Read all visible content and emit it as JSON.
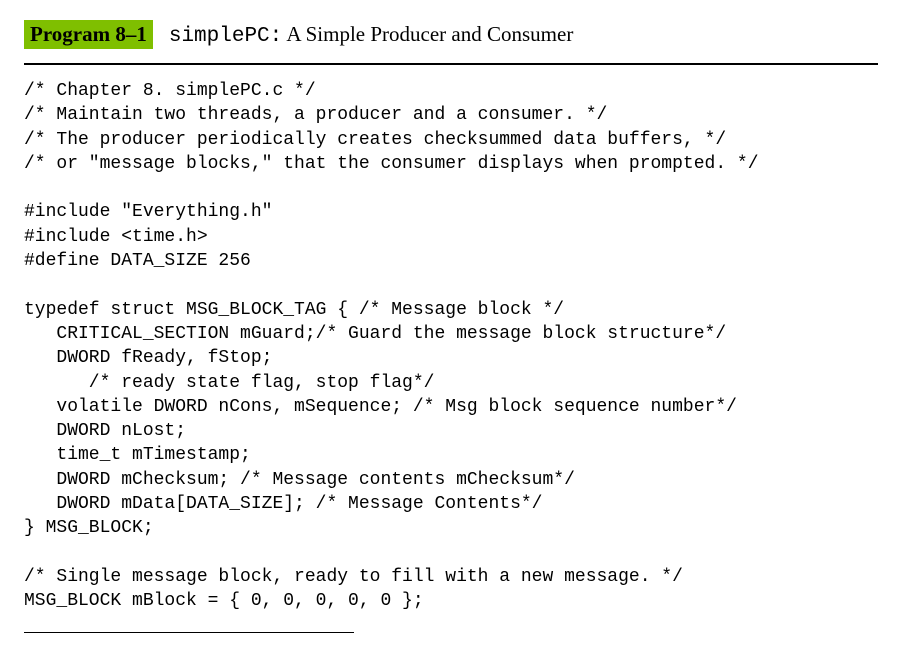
{
  "header": {
    "program_label": "Program 8–1",
    "code_name": "simplePC:",
    "description": " A Simple Producer and Consumer"
  },
  "code": {
    "lines": [
      "/* Chapter 8. simplePC.c */",
      "/* Maintain two threads, a producer and a consumer. */",
      "/* The producer periodically creates checksummed data buffers, */",
      "/* or \"message blocks,\" that the consumer displays when prompted. */",
      "",
      "#include \"Everything.h\"",
      "#include <time.h>",
      "#define DATA_SIZE 256",
      "",
      "typedef struct MSG_BLOCK_TAG { /* Message block */",
      "   CRITICAL_SECTION mGuard;/* Guard the message block structure*/",
      "   DWORD fReady, fStop;",
      "      /* ready state flag, stop flag*/",
      "   volatile DWORD nCons, mSequence; /* Msg block sequence number*/",
      "   DWORD nLost;",
      "   time_t mTimestamp;",
      "   DWORD mChecksum; /* Message contents mChecksum*/",
      "   DWORD mData[DATA_SIZE]; /* Message Contents*/",
      "} MSG_BLOCK;",
      "",
      "/* Single message block, ready to fill with a new message. */",
      "MSG_BLOCK mBlock = { 0, 0, 0, 0, 0 };"
    ]
  }
}
